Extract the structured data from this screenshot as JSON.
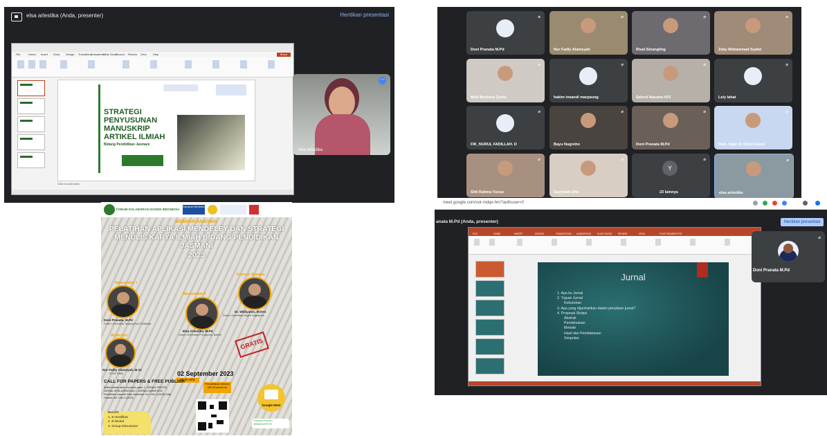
{
  "panel_a": {
    "presenter_label": "elsa arlestika (Anda, presenter)",
    "stop_label": "Hentikan presentasi",
    "camera_name": "elsa arlestika",
    "slide": {
      "title": "STRATEGI PENYUSUNAN MANUSKRIP ARTIKEL ILMIAH",
      "subtitle": "Bidang Pendidikan Jasmani"
    },
    "notes_placeholder": "Click to add notes",
    "ribbon_tabs": [
      "File",
      "Home",
      "Insert",
      "Draw",
      "Design",
      "Transitions",
      "Animations",
      "Slide Show",
      "Record",
      "Review",
      "View",
      "Help"
    ],
    "share_label": "Share"
  },
  "panel_b": {
    "tiles": [
      {
        "name": "Doni Pranata M.Pd",
        "style": "avatar",
        "bg": "#3c4043"
      },
      {
        "name": "Nur Fadly Alamsyah",
        "style": "video",
        "bg": "#9a8a70"
      },
      {
        "name": "Rival Sinangling",
        "style": "video",
        "bg": "#6d6a70"
      },
      {
        "name": "Zeky Mohammad Syafei",
        "style": "video",
        "bg": "#a08a78"
      },
      {
        "name": "Muh Maulana Genta",
        "style": "video",
        "bg": "#cfcac4"
      },
      {
        "name": "hakim irwandi marpaung",
        "style": "avatar",
        "bg": "#3c4043"
      },
      {
        "name": "Sahrul Nasuha H15",
        "style": "video",
        "bg": "#b6b0a8"
      },
      {
        "name": "Lely lahat",
        "style": "avatar",
        "bg": "#3c4043"
      },
      {
        "name": "FIK_NURUL FADILLAH. D",
        "style": "avatar",
        "bg": "#3c4043"
      },
      {
        "name": "Bayu Nugroho",
        "style": "video",
        "bg": "#4a4440"
      },
      {
        "name": "Doni Pranata M.Pd",
        "style": "video",
        "bg": "#6a6058"
      },
      {
        "name": "Muh. Fajar Al Qifari Faizal",
        "style": "video",
        "bg": "#c8d8f0"
      },
      {
        "name": "Sitti Rahma Yunus",
        "style": "video",
        "bg": "#a89080"
      },
      {
        "name": "Sayyidah Ulfa",
        "style": "video",
        "bg": "#d8cec4"
      },
      {
        "name": "23 lainnya",
        "style": "others",
        "bg": "#3c4043"
      },
      {
        "name": "elsa arlestika",
        "style": "video",
        "bg": "#8a9aa0"
      }
    ]
  },
  "panel_c": {
    "org": "FORUM KOLABORASI DOSEN INDONESIA",
    "kampus": "Kampus Merdeka",
    "kind": "WEBINAR NASIONAL",
    "title": "PELATIHAN APLIKASI MENDELEY DAN STRATEGI MENULIS KARYA ILMIAH BIDANG PENDIDIKAN JASMANI",
    "year": "2023",
    "speakers": [
      {
        "role": "Narasumber I",
        "name": "Doni Pranata, M.Pd",
        "aff": "Dosen Universitas Tanjung Pura Pontianak"
      },
      {
        "role": "Narasumber II",
        "name": "Elsa Arlestika, M.Pd",
        "aff": "Dosen Universitas Primagraha, Banten"
      },
      {
        "role": "Keynote Speaker",
        "name": "Dr. Widiyanto, M.Kes",
        "aff": "Dosen Universitas Negeri Yogyakarta"
      },
      {
        "role": "Moderator",
        "name": "Nur Fadly Alamsyah, M.Or",
        "aff": "STKIP BIMA"
      }
    ],
    "stamp": "GRATIS",
    "date": "02 September 2023",
    "time": "09.00 WIB",
    "register": "Pendaftaran Melalui QR di bawah ini",
    "cfp_title": "CALL FOR PAPERS & FREE PUBLISH",
    "cfp_details": "Artikel terbaik akan di publish pada: 1. JURNAL PRESTA, JURNAL KEOLAHRAGAAN 2. JURNAL MARATHON Pendidikan Jasmani Edisi Desember Vol. 3 No.2 (2023) Edisi Oktober Vol. 3 No.1 (2023)",
    "benefit_title": "Benefit:",
    "benefits": [
      "1. E-Sertifikat",
      "2. E-Modul",
      "3. Group Discussion"
    ],
    "meet_label": "Google Meet",
    "contact": "Contact Person 085654197079"
  },
  "panel_d": {
    "url": "meet.google.com/xot-mdqe-hrn?authuser=0",
    "presenter_label": "anata M.Pd (Anda, presenter)",
    "stop_label": "Hentikan presentasi",
    "camera_name": "Doni Pranata M.Pd",
    "ppt_tabs": [
      "FILE",
      "HOME",
      "INSERT",
      "DESIGN",
      "TRANSITIONS",
      "ANIMATIONS",
      "SLIDE SHOW",
      "REVIEW",
      "VIEW",
      "FOXIT READER PDF"
    ],
    "slide": {
      "title": "Jurnal",
      "bullets": [
        {
          "text": "1. Apa itu Jurnal",
          "sub": false
        },
        {
          "text": "2. Tujuan Jurnal",
          "sub": false
        },
        {
          "text": "Kebutuhan",
          "sub": true
        },
        {
          "text": "3. Apa yang diperhatikan dalam penulisan jurnal?",
          "sub": false
        },
        {
          "text": "4. Proposal Skripsi",
          "sub": false
        },
        {
          "text": "Abstrak",
          "sub": true
        },
        {
          "text": "Pendahuluan",
          "sub": true
        },
        {
          "text": "Metode",
          "sub": true
        },
        {
          "text": "Hasil dan Pembahasan",
          "sub": true
        },
        {
          "text": "Simpulan",
          "sub": true
        }
      ]
    }
  }
}
